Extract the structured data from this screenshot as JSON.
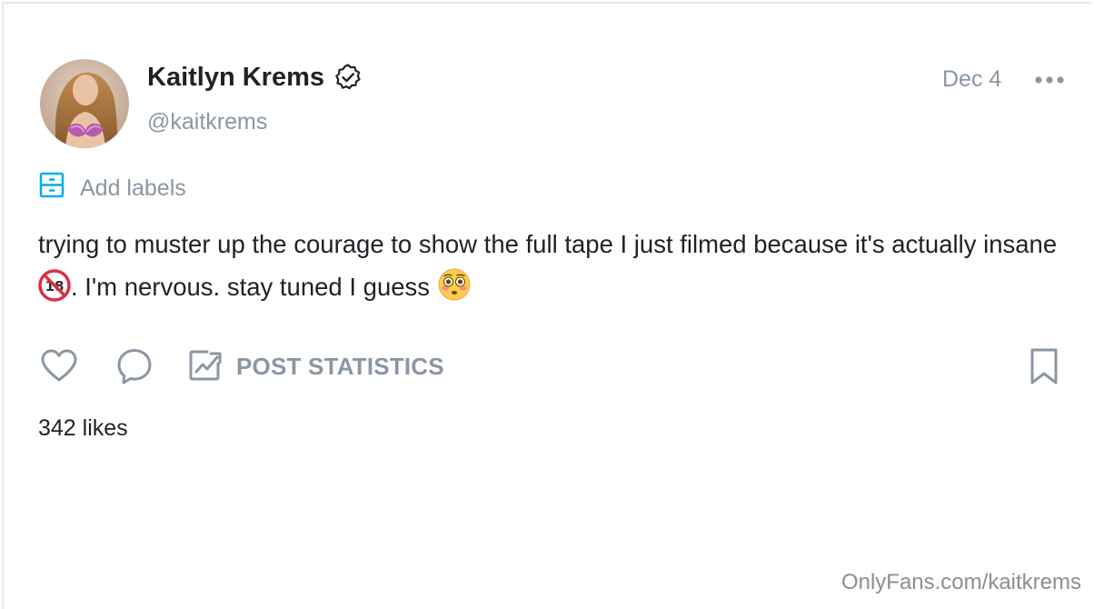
{
  "post": {
    "author_name": "Kaitlyn Krems",
    "handle": "@kaitkrems",
    "date": "Dec 4",
    "add_labels": "Add labels",
    "text_part1": "trying to muster up the courage to show the full tape I just filmed because it's actually insane",
    "text_part2": ". I'm nervous. stay tuned I guess",
    "post_statistics": "POST STATISTICS",
    "likes": "342 likes"
  },
  "icons": {
    "verified": "verified-badge-icon",
    "more": "more-dots-icon",
    "labels": "labels-icon",
    "like": "heart-icon",
    "comment": "comment-icon",
    "statistics": "statistics-chart-icon",
    "bookmark": "bookmark-icon",
    "emoji1": "no-one-under-eighteen-emoji",
    "emoji2": "flushed-face-emoji"
  },
  "colors": {
    "text": "#1e2227",
    "muted": "#8a96a3",
    "accent": "#00aff0"
  },
  "watermark": "OnlyFans.com/kaitkrems"
}
